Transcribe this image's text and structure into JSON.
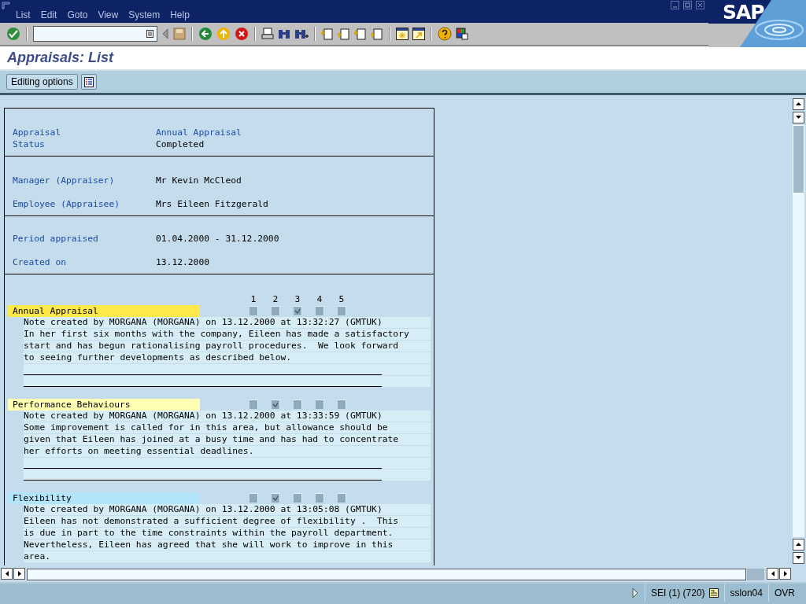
{
  "menu": [
    "List",
    "Edit",
    "Goto",
    "View",
    "System",
    "Help"
  ],
  "logo": "SAP",
  "title": "Appraisals: List",
  "app_toolbar": {
    "buttons": [
      "Editing options"
    ]
  },
  "header_groups": [
    {
      "fields": [
        {
          "label": "Appraisal",
          "value": "Annual Appraisal",
          "kind": "link"
        },
        {
          "label": "Status",
          "value": "Completed",
          "kind": "text"
        }
      ]
    },
    {
      "fields": [
        {
          "label": "Manager (Appraiser)",
          "value": "Mr Kevin McCleod",
          "kind": "text"
        },
        {
          "label": "Employee (Appraisee)",
          "value": "Mrs Eileen Fitzgerald",
          "kind": "text"
        }
      ]
    },
    {
      "fields": [
        {
          "label": "Period appraised",
          "value": "01.04.2000 - 31.12.2000",
          "kind": "text"
        },
        {
          "label": "Created on",
          "value": "13.12.2000",
          "kind": "text"
        }
      ]
    }
  ],
  "scale": [
    "1",
    "2",
    "3",
    "4",
    "5"
  ],
  "criteria": [
    {
      "name": "Annual Appraisal",
      "color": "#ffe84a",
      "ratings": [
        {
          "checked": false
        },
        {
          "checked": false
        },
        {
          "checked": true
        },
        {
          "checked": false
        },
        {
          "checked": false
        }
      ],
      "note_header": "Note created by MORGANA (MORGANA) on 13.12.2000 at 13:32:27 (GMTUK)",
      "note_lines": [
        "In her first six months with the company, Eileen has made a satisfactory",
        "start and has begun rationalising payroll procedures.  We look forward",
        "to seeing further developments as described below."
      ],
      "underlined_entry": true
    },
    {
      "name": "Performance Behaviours",
      "color": "#ffffb3",
      "ratings": [
        {
          "checked": false
        },
        {
          "checked": true
        },
        {
          "checked": false
        },
        {
          "checked": false
        },
        {
          "checked": false
        }
      ],
      "note_header": "Note created by MORGANA (MORGANA) on 13.12.2000 at 13:33:59 (GMTUK)",
      "note_lines": [
        "Some improvement is called for in this area, but allowance should be",
        "given that Eileen has joined at a busy time and has had to concentrate",
        "her efforts on meeting essential deadlines."
      ],
      "underlined_entry": true
    },
    {
      "name": "Flexibility",
      "color": "#b3e5fa",
      "ratings": [
        {
          "checked": false
        },
        {
          "checked": true
        },
        {
          "checked": false
        },
        {
          "checked": false
        },
        {
          "checked": false
        }
      ],
      "note_header": "Note created by MORGANA (MORGANA) on 13.12.2000 at 13:05:08 (GMTUK)",
      "note_lines": [
        "Eileen has not demonstrated a sufficient degree of flexibility .  This",
        "is due in part to the time constraints within the payroll department.",
        "Nevertheless, Eileen has agreed that she will work to improve in this",
        "area."
      ],
      "underlined_entry": false
    }
  ],
  "status_bar": {
    "session": "SEI (1) (720)",
    "server": "sslon04",
    "mode": "OVR"
  }
}
